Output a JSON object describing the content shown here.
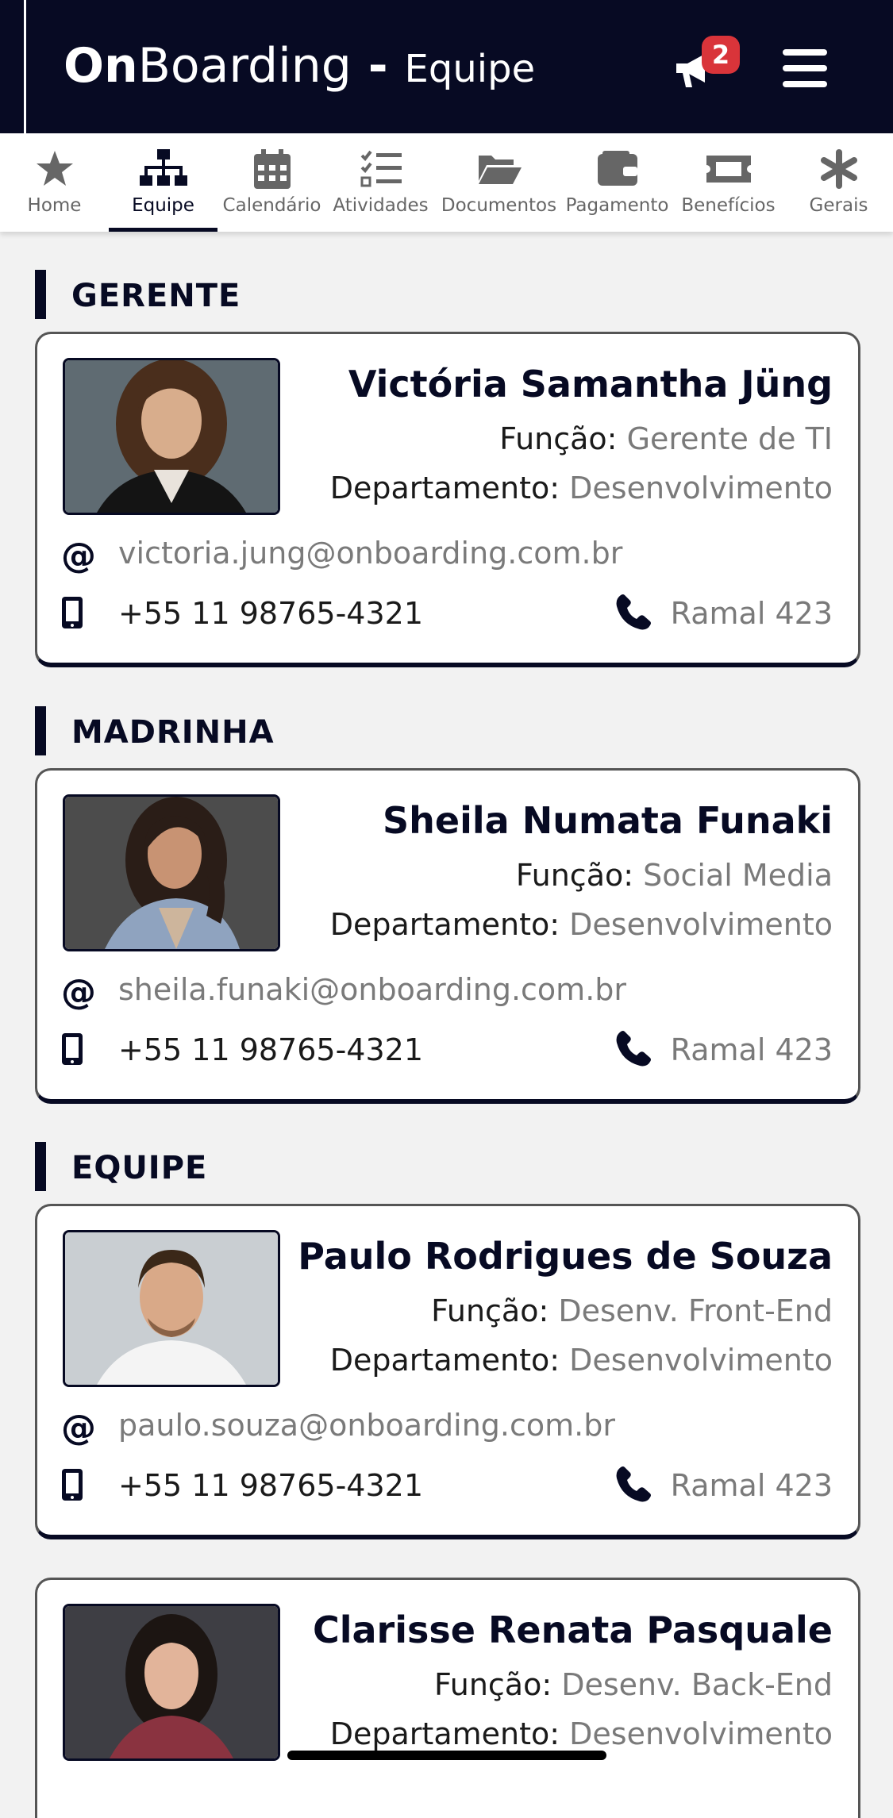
{
  "header": {
    "brand_on": "On",
    "brand_boarding": "Boarding",
    "brand_dash": " - ",
    "brand_section": "Equipe",
    "notification_count": "2",
    "icons": {
      "notifications": "megaphone-icon",
      "menu": "hamburger-icon"
    },
    "colors": {
      "background": "#070a23",
      "badge": "#d9343a"
    }
  },
  "tabs": [
    {
      "label": "Home",
      "icon": "star-icon"
    },
    {
      "label": "Equipe",
      "icon": "org-chart-icon",
      "active": true
    },
    {
      "label": "Calendário",
      "icon": "calendar-icon"
    },
    {
      "label": "Atividades",
      "icon": "checklist-icon"
    },
    {
      "label": "Documentos",
      "icon": "folder-open-icon"
    },
    {
      "label": "Pagamento",
      "icon": "wallet-icon"
    },
    {
      "label": "Benefícios",
      "icon": "ticket-icon"
    },
    {
      "label": "Gerais",
      "icon": "asterisk-icon"
    }
  ],
  "sections": [
    {
      "title": "GERENTE"
    },
    {
      "title": "MADRINHA"
    },
    {
      "title": "EQUIPE"
    }
  ],
  "labels": {
    "funcao": "Função: ",
    "departamento": "Departamento: "
  },
  "people": [
    {
      "name": "Victória Samantha Jüng",
      "funcao": "Gerente de TI",
      "departamento": "Desenvolvimento",
      "email": "victoria.jung@onboarding.com.br",
      "mobile": "+55 11 98765-4321",
      "ramal": "Ramal 423"
    },
    {
      "name": "Sheila Numata Funaki",
      "funcao": "Social Media",
      "departamento": "Desenvolvimento",
      "email": "sheila.funaki@onboarding.com.br",
      "mobile": "+55 11 98765-4321",
      "ramal": "Ramal 423"
    },
    {
      "name": "Paulo Rodrigues de Souza",
      "funcao": "Desenv. Front-End",
      "departamento": "Desenvolvimento",
      "email": "paulo.souza@onboarding.com.br",
      "mobile": "+55 11 98765-4321",
      "ramal": "Ramal 423"
    },
    {
      "name": "Clarisse Renata Pasquale",
      "funcao": "Desenv. Back-End",
      "departamento": "Desenvolvimento",
      "email": "",
      "mobile": "",
      "ramal": ""
    }
  ],
  "email_symbol": "@"
}
